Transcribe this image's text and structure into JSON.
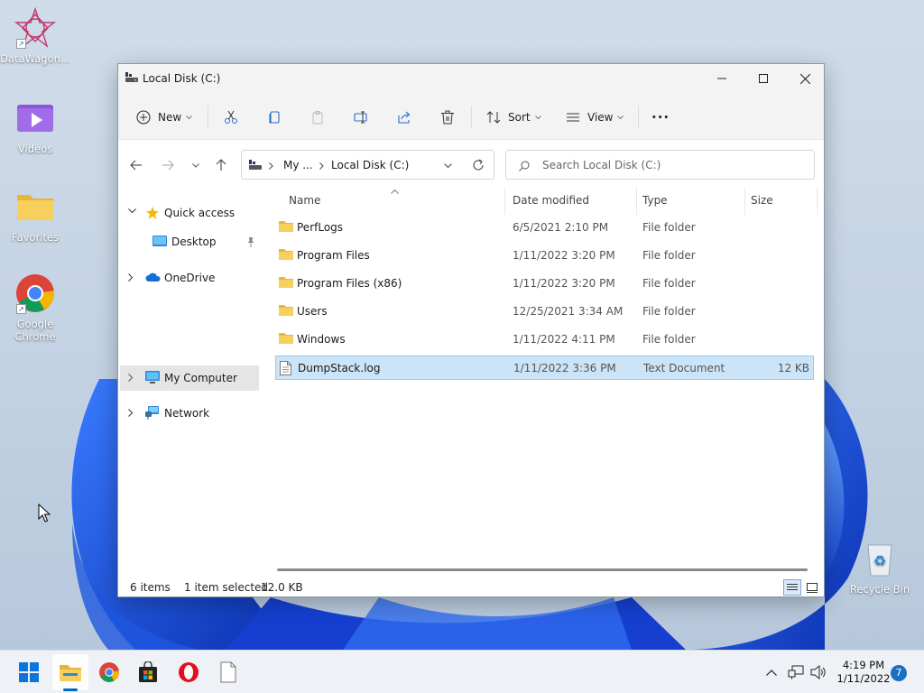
{
  "desktop": {
    "icons": [
      {
        "label": "DataWagon..."
      },
      {
        "label": "Videos"
      },
      {
        "label": "Favorites"
      },
      {
        "label": "Google Chrome"
      },
      {
        "label": "Recycle Bin"
      }
    ]
  },
  "window": {
    "title": "Local Disk (C:)",
    "toolbar": {
      "new_label": "New",
      "sort_label": "Sort",
      "view_label": "View",
      "more_label": "···"
    },
    "address": {
      "crumb_1": "My ...",
      "crumb_2": "Local Disk (C:)"
    },
    "search": {
      "placeholder": "Search Local Disk (C:)"
    },
    "sidebar": {
      "items": [
        {
          "label": "Quick access"
        },
        {
          "label": "Desktop"
        },
        {
          "label": "OneDrive"
        },
        {
          "label": "My Computer"
        },
        {
          "label": "Network"
        }
      ]
    },
    "columns": [
      "Name",
      "Date modified",
      "Type",
      "Size"
    ],
    "files": [
      {
        "name": "PerfLogs",
        "date": "6/5/2021 2:10 PM",
        "type": "File folder",
        "size": ""
      },
      {
        "name": "Program Files",
        "date": "1/11/2022 3:20 PM",
        "type": "File folder",
        "size": ""
      },
      {
        "name": "Program Files (x86)",
        "date": "1/11/2022 3:20 PM",
        "type": "File folder",
        "size": ""
      },
      {
        "name": "Users",
        "date": "12/25/2021 3:34 AM",
        "type": "File folder",
        "size": ""
      },
      {
        "name": "Windows",
        "date": "1/11/2022 4:11 PM",
        "type": "File folder",
        "size": ""
      },
      {
        "name": "DumpStack.log",
        "date": "1/11/2022 3:36 PM",
        "type": "Text Document",
        "size": "12 KB"
      }
    ],
    "status": {
      "count": "6 items",
      "selection": "1 item selected",
      "size": "12.0 KB"
    }
  },
  "taskbar": {
    "time": "4:19 PM",
    "date": "1/11/2022",
    "notifications": "7"
  },
  "colors": {
    "accent": "#0067c0",
    "selection": "#cce4f7",
    "folder": "#f4c542"
  }
}
